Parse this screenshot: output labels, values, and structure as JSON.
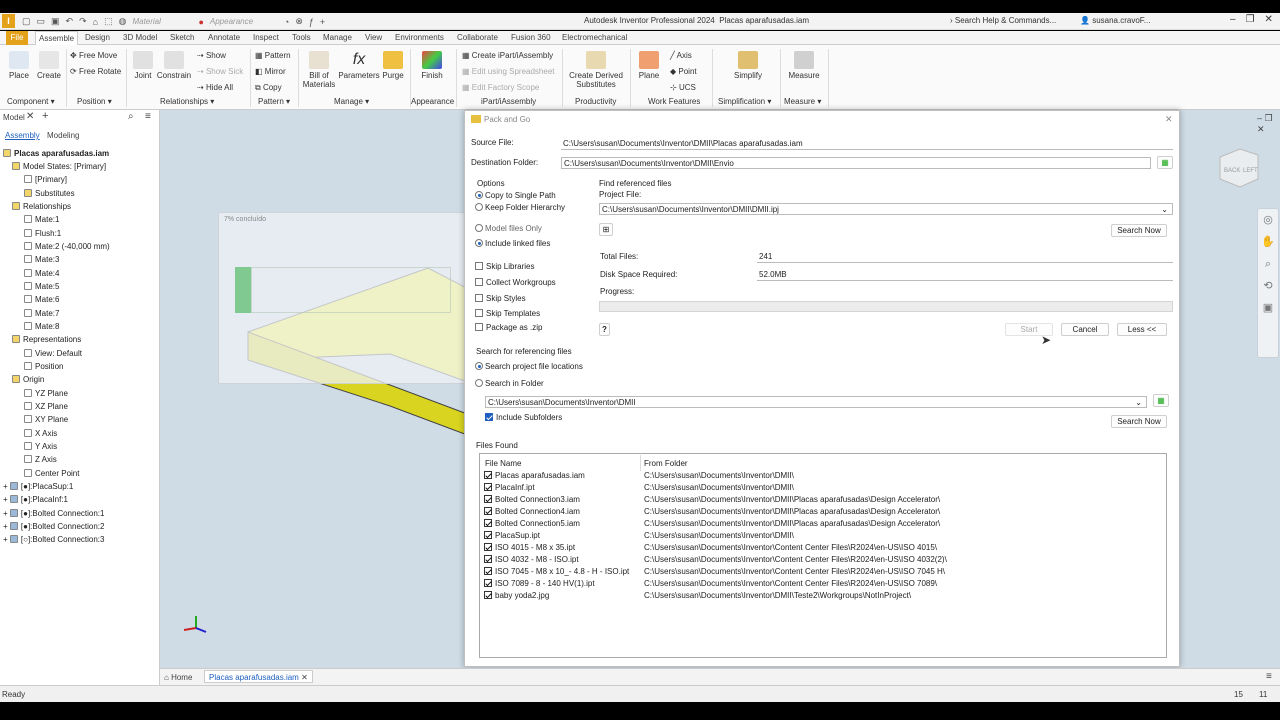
{
  "app": {
    "title": "Autodesk Inventor Professional 2024",
    "doc": "Placas aparafusadas.iam",
    "material_placeholder": "Material",
    "appearance_placeholder": "Appearance",
    "search_help": "Search Help & Commands...",
    "user": "susana.cravoF...",
    "icon_letter": "I"
  },
  "tabs": [
    "File",
    "Assemble",
    "Design",
    "3D Model",
    "Sketch",
    "Annotate",
    "Inspect",
    "Tools",
    "Manage",
    "View",
    "Environments",
    "Collaborate",
    "Fusion 360",
    "Electromechanical"
  ],
  "ribbon": {
    "place": "Place",
    "create": "Create",
    "free_move": "Free Move",
    "free_rotate": "Free Rotate",
    "joint": "Joint",
    "constrain": "Constrain",
    "show": "Show",
    "show_sick": "Show Sick",
    "hide_all": "Hide All",
    "pattern": "Pattern",
    "mirror": "Mirror",
    "copy": "Copy",
    "bom_1": "Bill of",
    "bom_2": "Materials",
    "parameters": "Parameters",
    "purge": "Purge",
    "finish": "Finish",
    "create_ipart": "Create iPart/iAssembly",
    "edit_spreadsheet": "Edit using Spreadsheet",
    "edit_factory": "Edit Factory Scope",
    "cds_1": "Create Derived",
    "cds_2": "Substitutes",
    "plane": "Plane",
    "axis": "Axis",
    "point": "Point",
    "ucs": "UCS",
    "simplify": "Simplify",
    "measure": "Measure",
    "groups": [
      "Component",
      "Position",
      "Relationships",
      "Pattern",
      "Manage",
      "Appearance",
      "iPart/iAssembly",
      "Productivity",
      "Work Features",
      "Simplification",
      "Measure"
    ]
  },
  "browser": {
    "tab_model": "Model",
    "tab_assembly": "Assembly",
    "tab_modeling": "Modeling",
    "items": [
      "Placas aparafusadas.iam",
      "Model States: [Primary]",
      "[Primary]",
      "Substitutes",
      "Relationships",
      "Mate:1",
      "Flush:1",
      "Mate:2 (-40,000 mm)",
      "Mate:3",
      "Mate:4",
      "Mate:5",
      "Mate:6",
      "Mate:7",
      "Mate:8",
      "Representations",
      "View: Default",
      "Position",
      "Origin",
      "YZ Plane",
      "XZ Plane",
      "XY Plane",
      "X Axis",
      "Y Axis",
      "Z Axis",
      "Center Point",
      "[●]:PlacaSup:1",
      "[●]:PlacaInf:1",
      "[●]:Bolted Connection:1",
      "[●]:Bolted Connection:2",
      "[○]:Bolted Connection:3"
    ]
  },
  "progress_window": {
    "title": "7% concluído"
  },
  "viewcube": {
    "back": "BACK",
    "left": "LEFT"
  },
  "dialog": {
    "title": "Pack and Go",
    "source_label": "Source File:",
    "source_value": "C:\\Users\\susan\\Documents\\Inventor\\DMII\\Placas aparafusadas.iam",
    "dest_label": "Destination Folder:",
    "dest_value": "C:\\Users\\susan\\Documents\\Inventor\\DMII\\Envio",
    "options_label": "Options",
    "copy_single": "Copy to Single Path",
    "keep_hier": "Keep Folder Hierarchy",
    "model_only": "Model files Only",
    "include_linked": "Include linked files",
    "skip_libraries": "Skip Libraries",
    "collect_workgroups": "Collect Workgroups",
    "skip_styles": "Skip Styles",
    "skip_templates": "Skip Templates",
    "package_zip": "Package as .zip",
    "find_ref": "Find referenced files",
    "project_label": "Project File:",
    "project_value": "C:\\Users\\susan\\Documents\\Inventor\\DMII\\DMII.ipj",
    "search_now": "Search Now",
    "total_label": "Total Files:",
    "total_value": "241",
    "disk_label": "Disk Space Required:",
    "disk_value": "52.0MB",
    "progress_label": "Progress:",
    "progress": 0,
    "start": "Start",
    "cancel": "Cancel",
    "less": "Less <<",
    "search_ref_label": "Search for referencing files",
    "search_project": "Search project file locations",
    "search_folder": "Search in Folder",
    "folder_value": "C:\\Users\\susan\\Documents\\Inventor\\DMII",
    "include_sub": "Include Subfolders",
    "search_now2": "Search Now",
    "files_found": "Files Found",
    "col_name": "File Name",
    "col_folder": "From Folder",
    "files": [
      {
        "name": "Placas aparafusadas.iam",
        "folder": "C:\\Users\\susan\\Documents\\Inventor\\DMII\\"
      },
      {
        "name": "PlacaInf.ipt",
        "folder": "C:\\Users\\susan\\Documents\\Inventor\\DMII\\"
      },
      {
        "name": "Bolted Connection3.iam",
        "folder": "C:\\Users\\susan\\Documents\\Inventor\\DMII\\Placas aparafusadas\\Design Accelerator\\"
      },
      {
        "name": "Bolted Connection4.iam",
        "folder": "C:\\Users\\susan\\Documents\\Inventor\\DMII\\Placas aparafusadas\\Design Accelerator\\"
      },
      {
        "name": "Bolted Connection5.iam",
        "folder": "C:\\Users\\susan\\Documents\\Inventor\\DMII\\Placas aparafusadas\\Design Accelerator\\"
      },
      {
        "name": "PlacaSup.ipt",
        "folder": "C:\\Users\\susan\\Documents\\Inventor\\DMII\\"
      },
      {
        "name": "ISO 4015 - M8 x 35.ipt",
        "folder": "C:\\Users\\susan\\Documents\\Inventor\\Content Center Files\\R2024\\en-US\\ISO 4015\\"
      },
      {
        "name": "ISO 4032 - M8 - ISO.ipt",
        "folder": "C:\\Users\\susan\\Documents\\Inventor\\Content Center Files\\R2024\\en-US\\ISO 4032(2)\\"
      },
      {
        "name": "ISO 7045 - M8 x 10_- 4.8 - H - ISO.ipt",
        "folder": "C:\\Users\\susan\\Documents\\Inventor\\Content Center Files\\R2024\\en-US\\ISO 7045  H\\"
      },
      {
        "name": "ISO 7089 - 8 - 140 HV(1).ipt",
        "folder": "C:\\Users\\susan\\Documents\\Inventor\\Content Center Files\\R2024\\en-US\\ISO 7089\\"
      },
      {
        "name": "baby yoda2.jpg",
        "folder": "C:\\Users\\susan\\Documents\\Inventor\\DMII\\Teste2\\Workgroups\\NotInProject\\"
      }
    ]
  },
  "bottom": {
    "home": "Home",
    "doc_tab": "Placas aparafusadas.iam"
  },
  "status": {
    "text": "Ready",
    "n1": "15",
    "n2": "11"
  },
  "colors": {
    "accent": "#e3a21a",
    "selection": "#1f5fbf",
    "part": "#f2ef3a"
  }
}
